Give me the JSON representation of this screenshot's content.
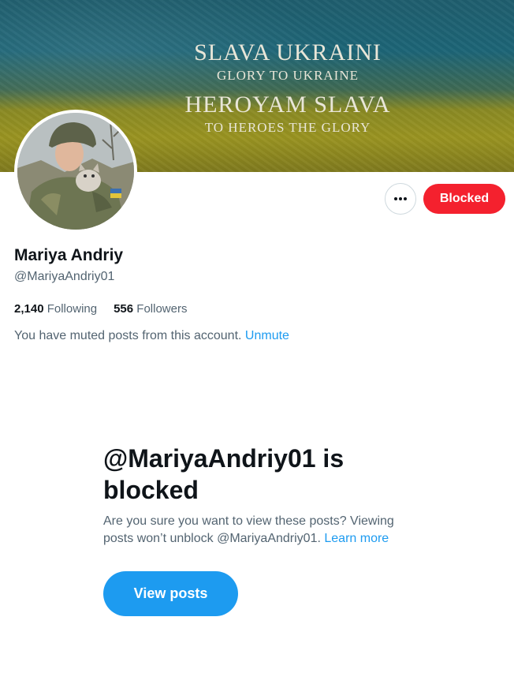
{
  "banner": {
    "line1": "SLAVA UKRAINI",
    "line2": "GLORY TO UKRAINE",
    "line3": "HEROYAM SLAVA",
    "line4": "TO HEROES THE GLORY"
  },
  "profile": {
    "name": "Mariya Andriy",
    "handle": "@MariyaAndriy01",
    "following_count": "2,140",
    "following_label": "Following",
    "followers_count": "556",
    "followers_label": "Followers"
  },
  "actions": {
    "more_icon": "more-horizontal-icon",
    "blocked_label": "Blocked"
  },
  "muted_notice": {
    "text": "You have muted posts from this account.",
    "unmute_label": "Unmute"
  },
  "blocked_panel": {
    "title": "@MariyaAndriy01 is blocked",
    "description": "Are you sure you want to view these posts? Viewing posts won’t unblock @MariyaAndriy01.",
    "learn_more_label": "Learn more",
    "view_posts_label": "View posts"
  },
  "colors": {
    "accent": "#1d9bf0",
    "blocked_red": "#f4212e",
    "secondary_text": "#536471",
    "primary_text": "#0f1419"
  }
}
